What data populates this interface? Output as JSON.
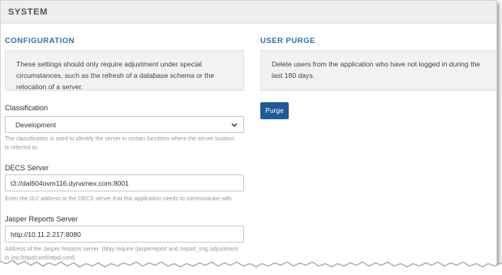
{
  "header": {
    "title": "SYSTEM"
  },
  "configuration": {
    "title": "CONFIGURATION",
    "info": "These settings should only require adjustment under special circumstances, such as the refresh of a database schema or the relocation of a server.",
    "classification": {
      "label": "Classification",
      "selected": "Development",
      "help": "The classification is used to identify the server in certain functions where the server location is referred to."
    },
    "decs_server": {
      "label": "DECS Server",
      "value": "t3://dal604ovm116.dynamex.com:8001",
      "help": "Enter the t3:// address to the DECS server that this application needs to communicate with."
    },
    "jasper_server": {
      "label": "Jasper Reports Server",
      "value": "http://10.11.2.217:8080",
      "help": "Address of the Jasper Reports server. (May require /jasperreport and /report_img adjustment in /etc/httpd/conf/httpd.conf)"
    }
  },
  "user_purge": {
    "title": "USER PURGE",
    "info": "Delete users from the application who have not logged in during the last 180 days.",
    "button_label": "Purge"
  },
  "icons": {
    "select_arrow": "chevron-down-icon"
  },
  "colors": {
    "accent": "#2d6fa8",
    "button": "#1f5c97"
  }
}
